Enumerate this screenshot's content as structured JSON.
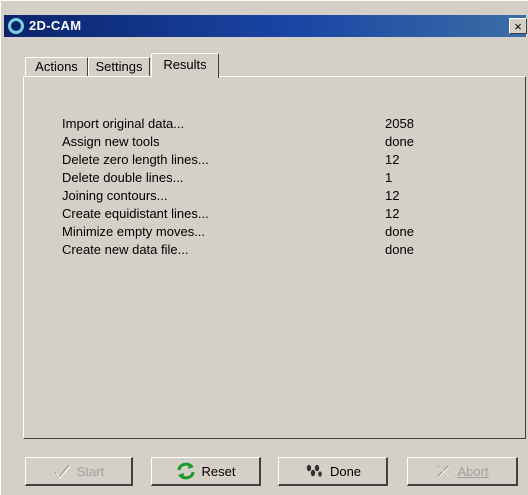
{
  "window": {
    "title": "2D-CAM",
    "close_label": "×"
  },
  "tabs": [
    {
      "label": "Actions"
    },
    {
      "label": "Settings"
    },
    {
      "label": "Results"
    }
  ],
  "results": [
    {
      "label": "Import original data...",
      "value": "2058"
    },
    {
      "label": "Assign new tools",
      "value": "done"
    },
    {
      "label": "Delete zero length lines...",
      "value": "12"
    },
    {
      "label": "Delete double lines...",
      "value": "1"
    },
    {
      "label": "Joining contours...",
      "value": "12"
    },
    {
      "label": "Create equidistant lines...",
      "value": "12"
    },
    {
      "label": "Minimize empty moves...",
      "value": "done"
    },
    {
      "label": "Create new data file...",
      "value": "done"
    }
  ],
  "buttons": {
    "start": {
      "label": "Start",
      "icon": "check-icon",
      "enabled": false
    },
    "reset": {
      "label": "Reset",
      "icon": "refresh-icon",
      "enabled": true
    },
    "done": {
      "label": "Done",
      "icon": "footsteps-icon",
      "enabled": true
    },
    "abort": {
      "label": "Abort",
      "icon": "cross-icon",
      "enabled": false
    }
  },
  "colors": {
    "accent": "#0a246a",
    "refresh_green": "#1a9a2a",
    "face": "#d4d0c8"
  }
}
